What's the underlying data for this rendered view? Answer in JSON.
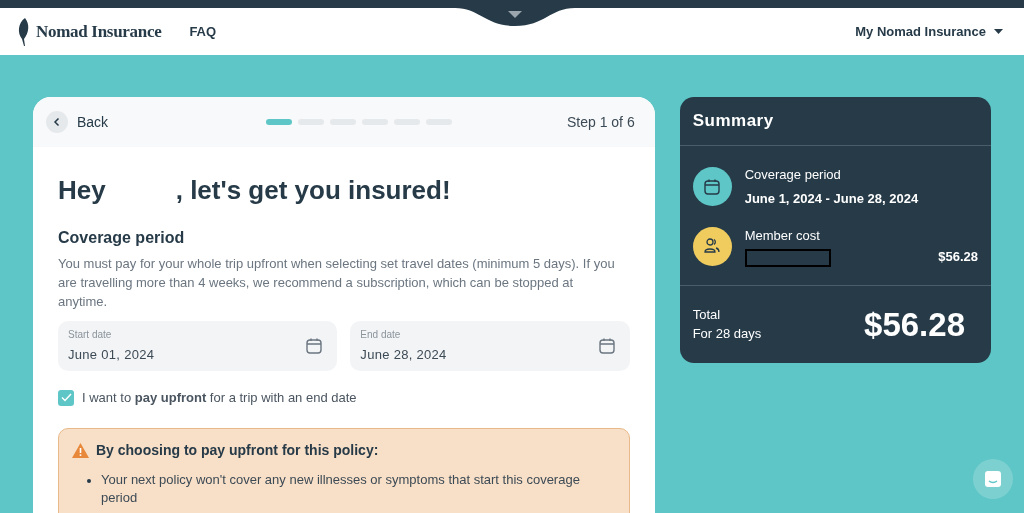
{
  "header": {
    "brand": "Nomad Insurance",
    "nav": [
      "FAQ"
    ],
    "account_menu": "My Nomad Insurance"
  },
  "form": {
    "back": "Back",
    "steps": [
      {
        "selected": true
      },
      {
        "selected": false
      },
      {
        "selected": false
      },
      {
        "selected": false
      },
      {
        "selected": false
      },
      {
        "selected": false
      }
    ],
    "step_label": "Step 1 of 6",
    "greeting_start": "Hey",
    "greeting_end": ", let's get you insured!",
    "section_title": "Coverage period",
    "description": "You must pay for your whole trip upfront when selecting set travel dates (minimum 5 days). If you are travelling more than 4 weeks, we recommend a subscription, which can be stopped at anytime.",
    "fields": [
      {
        "label": "Start date",
        "value": "June 01, 2024"
      },
      {
        "label": "End date",
        "value": "June 28, 2024"
      }
    ],
    "checkbox": {
      "label": "I want to **pay upfront** for a trip with an end date",
      "checked": true
    },
    "notice": {
      "title": "By choosing to pay upfront for this policy:",
      "items": [
        "Your next policy won't cover any new illnesses or symptoms that start this coverage period"
      ]
    }
  },
  "summary": {
    "title": "Summary",
    "rows": [
      {
        "kind": "period",
        "label": "Coverage period",
        "value": "June 1, 2024 - June 28, 2024"
      },
      {
        "kind": "member",
        "label": "Member cost",
        "amount": "$56.28"
      }
    ],
    "total_label": "Total",
    "total_sub": "For 28 days",
    "total": "$56.28"
  }
}
